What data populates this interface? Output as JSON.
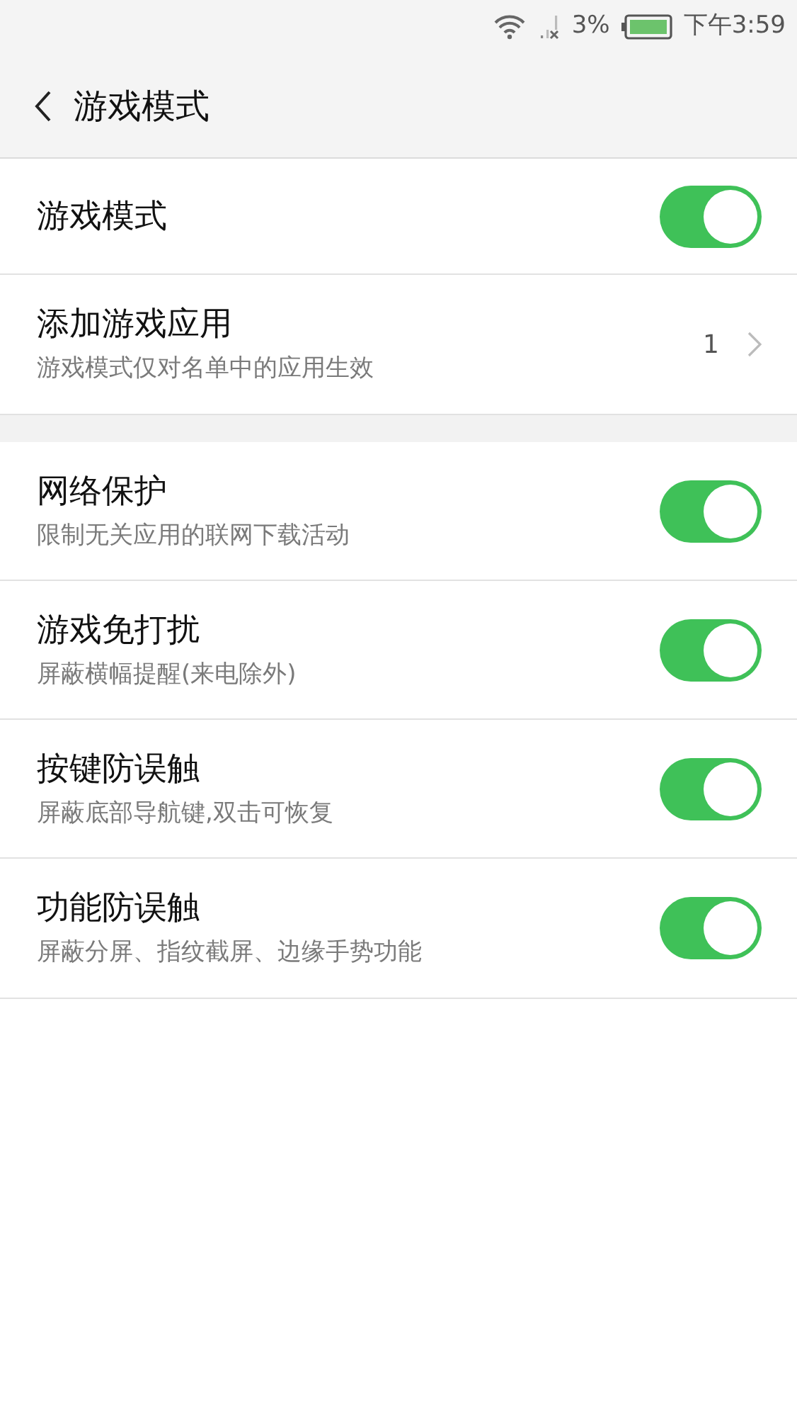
{
  "status_bar": {
    "battery": "3%",
    "time": "下午3:59"
  },
  "header": {
    "title": "游戏模式"
  },
  "sections": [
    {
      "items": [
        {
          "kind": "toggle",
          "title": "游戏模式",
          "on": true
        },
        {
          "kind": "link",
          "title": "添加游戏应用",
          "subtitle": "游戏模式仅对名单中的应用生效",
          "value": "1"
        }
      ]
    },
    {
      "items": [
        {
          "kind": "toggle",
          "title": "网络保护",
          "subtitle": "限制无关应用的联网下载活动",
          "on": true
        },
        {
          "kind": "toggle",
          "title": "游戏免打扰",
          "subtitle": "屏蔽横幅提醒(来电除外)",
          "on": true
        },
        {
          "kind": "toggle",
          "title": "按键防误触",
          "subtitle": "屏蔽底部导航键,双击可恢复",
          "on": true
        },
        {
          "kind": "toggle",
          "title": "功能防误触",
          "subtitle": "屏蔽分屏、指纹截屏、边缘手势功能",
          "on": true
        }
      ]
    }
  ]
}
